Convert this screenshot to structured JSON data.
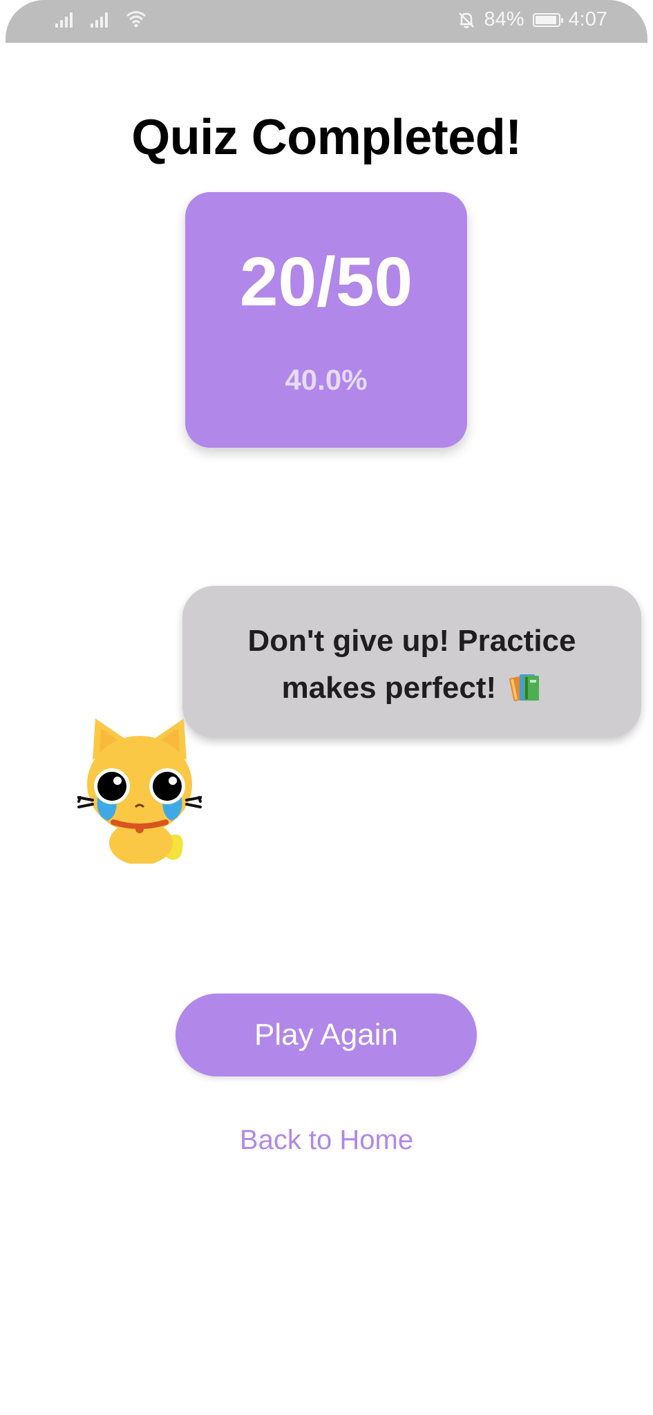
{
  "status_bar": {
    "battery": "84%",
    "time": "4:07",
    "icons": [
      "signal-icon",
      "signal-icon",
      "wifi-icon",
      "mute-icon",
      "battery-icon"
    ]
  },
  "title": "Quiz Completed!",
  "score": {
    "value": "20/50",
    "percent": "40.0%"
  },
  "message": {
    "text": "Don't give up! Practice makes perfect!",
    "icon": "books-icon"
  },
  "mascot": "crying-cat",
  "buttons": {
    "play_again": "Play Again",
    "back_home": "Back to Home"
  },
  "colors": {
    "accent": "#b187ea",
    "bubble": "#cfcdcf",
    "status_bar": "#bdbdbd"
  }
}
